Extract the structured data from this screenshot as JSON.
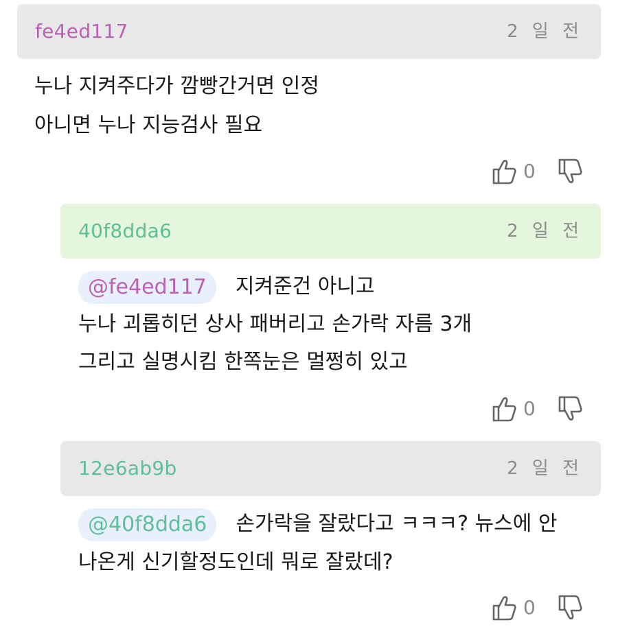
{
  "comments": [
    {
      "username": "fe4ed117",
      "user_color": "#b862b2",
      "header_bg": "#e8e8e8",
      "time": "2 일 전",
      "lines": [
        "누나 지켜주다가 깜빵간거면 인정",
        "아니면 누나 지능검사 필요"
      ],
      "likes": "0"
    },
    {
      "username": "40f8dda6",
      "user_color": "#5fbf9a",
      "header_bg": "#e4f6dc",
      "time": "2 일 전",
      "mention": "@fe4ed117",
      "mention_color": "#b862b2",
      "lines": [
        "지켜준건 아니고",
        "누나 괴롭히던 상사 패버리고 손가락 자름 3개",
        "그리고 실명시킴 한쪽눈은 멀쩡히 있고"
      ],
      "likes": "0"
    },
    {
      "username": "12e6ab9b",
      "user_color": "#5fbf9a",
      "header_bg": "#e8e8e8",
      "time": "2 일 전",
      "mention": "@40f8dda6",
      "mention_color": "#5fbf9a",
      "lines": [
        "손가락을 잘랐다고 ㅋㅋㅋ? 뉴스에 안",
        "나온게 신기할정도인데 뭐로 잘랐데?"
      ],
      "likes": "0"
    }
  ]
}
